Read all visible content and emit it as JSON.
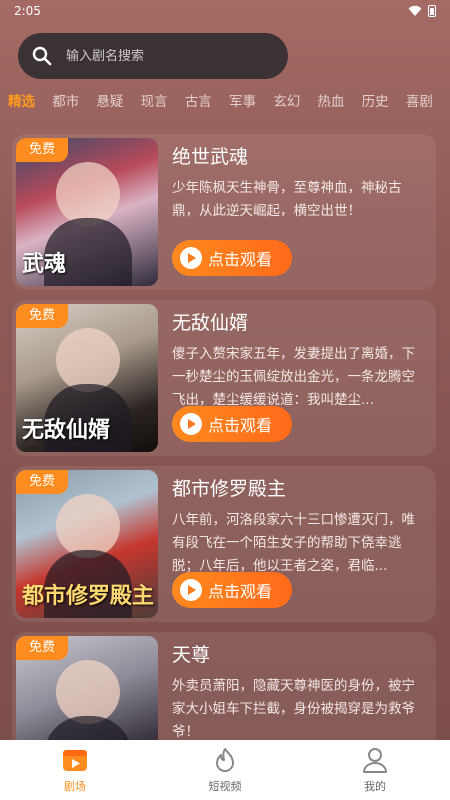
{
  "status": {
    "time": "2:05"
  },
  "search": {
    "placeholder": "输入剧名搜索"
  },
  "tabs": [
    "精选",
    "都市",
    "悬疑",
    "现言",
    "古言",
    "军事",
    "玄幻",
    "热血",
    "历史",
    "喜剧"
  ],
  "active_tab": "精选",
  "colors": {
    "accent": "#ff8c1f",
    "search_bg": "#3a3234",
    "nav_bg": "#ffffff"
  },
  "badge_label": "免费",
  "watch_label": "点击观看",
  "dramas": [
    {
      "title": "绝世武魂",
      "description": "少年陈枫天生神骨，至尊神血，神秘古鼎，从此逆天崛起，横空出世！",
      "poster_text": "武魂"
    },
    {
      "title": "无敌仙婿",
      "description": "傻子入赘宋家五年，发妻提出了离婚，下一秒楚尘的玉佩绽放出金光，一条龙腾空飞出，楚尘缓缓说道：我叫楚尘...",
      "poster_text": "无敌仙婿"
    },
    {
      "title": "都市修罗殿主",
      "description": "八年前，河洛段家六十三口惨遭灭门，唯有段飞在一个陌生女子的帮助下侥幸逃脱；八年后，他以王者之姿，君临...",
      "poster_text": "都市修罗殿主"
    },
    {
      "title": "天尊",
      "description": "外卖员萧阳，隐藏天尊神医的身份，被宁家大小姐车下拦截，身份被揭穿是为救爷爷！",
      "poster_text": ""
    }
  ],
  "bottom_nav": [
    {
      "label": "剧场",
      "icon": "theater-icon",
      "active": true
    },
    {
      "label": "短视频",
      "icon": "flame-icon",
      "active": false
    },
    {
      "label": "我的",
      "icon": "profile-icon",
      "active": false
    }
  ]
}
